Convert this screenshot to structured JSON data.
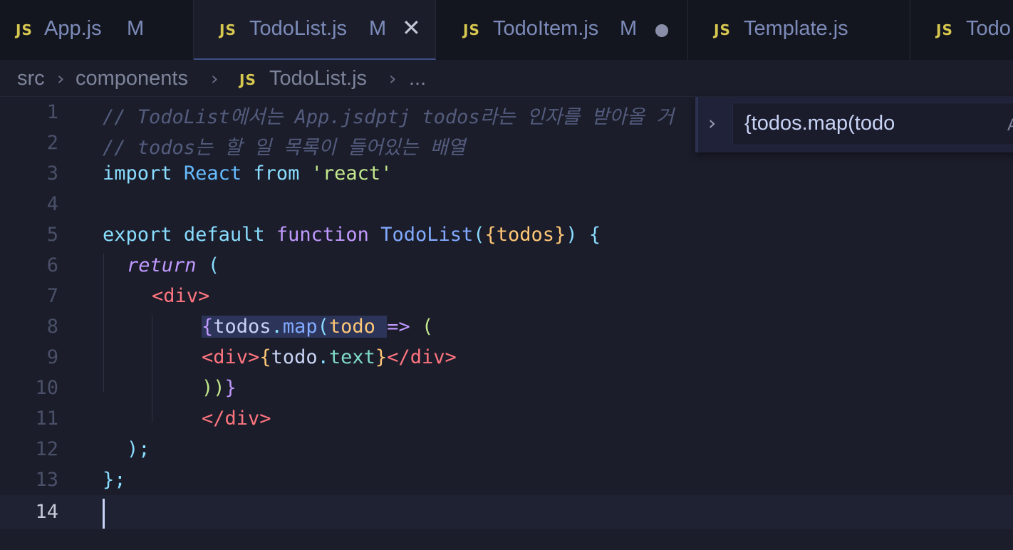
{
  "tabs": [
    {
      "icon": "JS",
      "name": "App.js",
      "status": "M"
    },
    {
      "icon": "JS",
      "name": "TodoList.js",
      "status": "M",
      "active": true
    },
    {
      "icon": "JS",
      "name": "TodoItem.js",
      "status": "M"
    },
    {
      "icon": "JS",
      "name": "Template.js",
      "status": ""
    },
    {
      "icon": "JS",
      "name": "Todo",
      "status": ""
    }
  ],
  "breadcrumb": {
    "folder1": "src",
    "folder2": "components",
    "file_icon": "JS",
    "file": "TodoList.js",
    "more": "..."
  },
  "find": {
    "query": "{todos.map(todo",
    "option": "A"
  },
  "editor": {
    "line_numbers": [
      "1",
      "2",
      "3",
      "4",
      "5",
      "6",
      "7",
      "8",
      "9",
      "10",
      "11",
      "12",
      "13",
      "14"
    ],
    "current_line": "14",
    "l1": "// TodoList에서는 App.jsdptj todos라는 인자를 받아올 거",
    "l2": "// todos는 할 일 목록이 들어있는 배열",
    "l3": {
      "kw": "import",
      "cls": "React",
      "from": "from",
      "str": "'react'"
    },
    "l5": {
      "export": "export",
      "default": "default",
      "function": "function",
      "name": "TodoList",
      "open": "(",
      "brace_open": "{",
      "param": "todos",
      "brace_close": "}",
      "close": ")",
      "block": "{"
    },
    "l6": {
      "kw": "return",
      "paren": "("
    },
    "l7": {
      "lt": "<",
      "tag": "div",
      "gt": ">"
    },
    "l8": {
      "brace": "{",
      "obj": "todos",
      "dot": ".",
      "method": "map",
      "paren": "(",
      "param": "todo",
      "arrow": "=>",
      "paren2": "("
    },
    "l9": {
      "lt": "<",
      "tag": "div",
      "gt": ">",
      "brace_open": "{",
      "obj": "todo",
      "dot": ".",
      "prop": "text",
      "brace_close": "}",
      "lt_close": "</",
      "tag2": "div",
      "gt2": ">"
    },
    "l10": {
      "parens": "))",
      "brace": "}"
    },
    "l11": {
      "lt": "</",
      "tag": "div",
      "gt": ">"
    },
    "l12": {
      "text": ");"
    },
    "l13": {
      "text": "};"
    }
  }
}
